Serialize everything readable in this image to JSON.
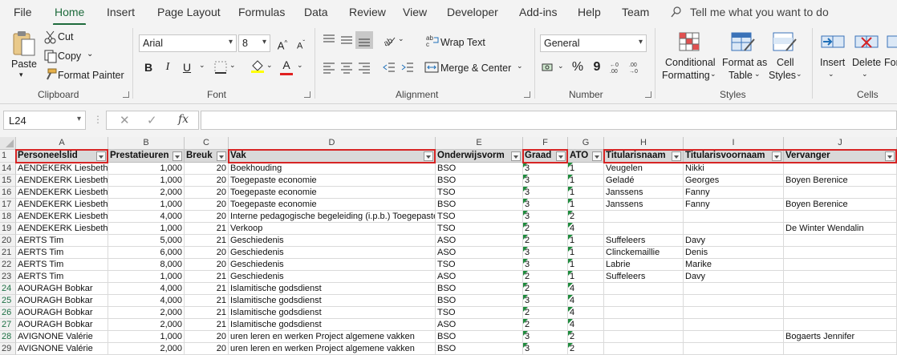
{
  "tabs": [
    "File",
    "Home",
    "Insert",
    "Page Layout",
    "Formulas",
    "Data",
    "Review",
    "View",
    "Developer",
    "Add-ins",
    "Help",
    "Team"
  ],
  "active_tab": "Home",
  "tell_me": "Tell me what you want to do",
  "ribbon": {
    "clipboard": {
      "label": "Clipboard",
      "paste": "Paste",
      "cut": "Cut",
      "copy": "Copy",
      "format_painter": "Format Painter"
    },
    "font": {
      "label": "Font",
      "font_name": "Arial",
      "font_size": "8",
      "bold": "B",
      "italic": "I",
      "underline": "U"
    },
    "alignment": {
      "label": "Alignment",
      "wrap_text": "Wrap Text",
      "merge_center": "Merge & Center"
    },
    "number": {
      "label": "Number",
      "format": "General",
      "percent": "%",
      "comma": "9"
    },
    "styles": {
      "label": "Styles",
      "conditional_1": "Conditional",
      "conditional_2": "Formatting",
      "format_table_1": "Format as",
      "format_table_2": "Table",
      "cell_styles_1": "Cell",
      "cell_styles_2": "Styles"
    },
    "cells": {
      "label": "Cells",
      "insert": "Insert",
      "delete": "Delete",
      "format": "For"
    }
  },
  "formula_bar": {
    "name_box": "L24",
    "fx": "fx",
    "formula": ""
  },
  "columns": [
    "A",
    "B",
    "C",
    "D",
    "E",
    "F",
    "G",
    "H",
    "I",
    "J"
  ],
  "header_row_number": "1",
  "headers": [
    "Personeelslid",
    "Prestatieuren",
    "Breuk",
    "Vak",
    "Onderwijsvorm",
    "Graad",
    "ATO",
    "Titularisnaam",
    "Titularisvoornaam",
    "Vervanger"
  ],
  "rows": [
    {
      "n": "14",
      "c": [
        "AENDEKERK Liesbeth",
        "1,000",
        "20",
        "Boekhouding",
        "BSO",
        "3",
        "1",
        "Veugelen",
        "Nikki",
        ""
      ]
    },
    {
      "n": "15",
      "c": [
        "AENDEKERK Liesbeth",
        "1,000",
        "20",
        "Toegepaste economie",
        "BSO",
        "3",
        "1",
        "Geladé",
        "Georges",
        "Boyen Berenice"
      ]
    },
    {
      "n": "16",
      "c": [
        "AENDEKERK Liesbeth",
        "2,000",
        "20",
        "Toegepaste economie",
        "TSO",
        "3",
        "1",
        "Janssens",
        "Fanny",
        ""
      ]
    },
    {
      "n": "17",
      "c": [
        "AENDEKERK Liesbeth",
        "1,000",
        "20",
        "Toegepaste economie",
        "BSO",
        "3",
        "1",
        "Janssens",
        "Fanny",
        "Boyen Berenice"
      ]
    },
    {
      "n": "18",
      "c": [
        "AENDEKERK Liesbeth",
        "4,000",
        "20",
        "Interne pedagogische begeleiding (i.p.b.) Toegepaste",
        "TSO",
        "3",
        "2",
        "",
        "",
        ""
      ]
    },
    {
      "n": "19",
      "c": [
        "AENDEKERK Liesbeth",
        "1,000",
        "21",
        "Verkoop",
        "TSO",
        "2",
        "4",
        "",
        "",
        "De Winter Wendalin"
      ]
    },
    {
      "n": "20",
      "c": [
        "AERTS Tim",
        "5,000",
        "21",
        "Geschiedenis",
        "ASO",
        "2",
        "1",
        "Suffeleers",
        "Davy",
        ""
      ]
    },
    {
      "n": "21",
      "c": [
        "AERTS Tim",
        "6,000",
        "20",
        "Geschiedenis",
        "ASO",
        "3",
        "1",
        "Clinckemaillie",
        "Denis",
        ""
      ]
    },
    {
      "n": "22",
      "c": [
        "AERTS Tim",
        "8,000",
        "20",
        "Geschiedenis",
        "TSO",
        "3",
        "1",
        "Labrie",
        "Marike",
        ""
      ]
    },
    {
      "n": "23",
      "c": [
        "AERTS Tim",
        "1,000",
        "21",
        "Geschiedenis",
        "ASO",
        "2",
        "1",
        "Suffeleers",
        "Davy",
        ""
      ]
    },
    {
      "n": "24",
      "c": [
        "AOURAGH Bobkar",
        "4,000",
        "21",
        "Islamitische godsdienst",
        "BSO",
        "2",
        "4",
        "",
        "",
        ""
      ]
    },
    {
      "n": "25",
      "c": [
        "AOURAGH Bobkar",
        "4,000",
        "21",
        "Islamitische godsdienst",
        "BSO",
        "3",
        "4",
        "",
        "",
        ""
      ]
    },
    {
      "n": "26",
      "c": [
        "AOURAGH Bobkar",
        "2,000",
        "21",
        "Islamitische godsdienst",
        "TSO",
        "2",
        "4",
        "",
        "",
        ""
      ]
    },
    {
      "n": "27",
      "c": [
        "AOURAGH Bobkar",
        "2,000",
        "21",
        "Islamitische godsdienst",
        "ASO",
        "2",
        "4",
        "",
        "",
        ""
      ]
    },
    {
      "n": "28",
      "c": [
        "AVIGNONE Valérie",
        "1,000",
        "20",
        "uren leren en werken Project algemene vakken",
        "BSO",
        "3",
        "2",
        "",
        "",
        "Bogaerts Jennifer"
      ]
    },
    {
      "n": "29",
      "c": [
        "AVIGNONE Valérie",
        "2,000",
        "20",
        "uren leren en werken Project algemene vakken",
        "BSO",
        "3",
        "2",
        "",
        "",
        ""
      ]
    }
  ],
  "highlight_color": "#d62424",
  "accent_color": "#1e6b3c"
}
